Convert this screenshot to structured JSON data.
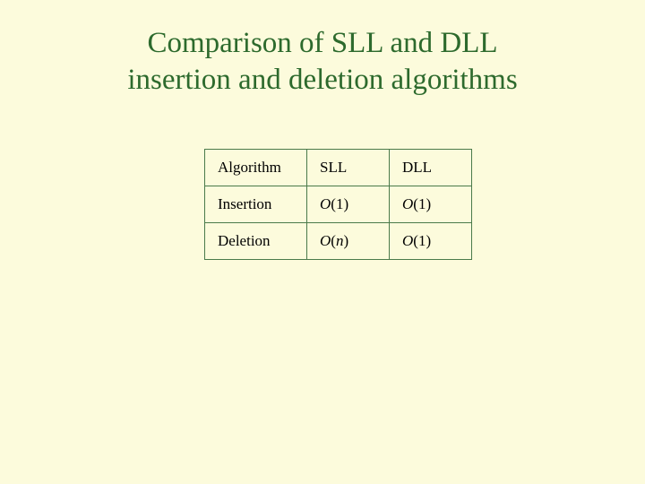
{
  "title_line1": "Comparison of SLL and DLL",
  "title_line2": "insertion and deletion algorithms",
  "chart_data": {
    "type": "table",
    "headers": [
      "Algorithm",
      "SLL",
      "DLL"
    ],
    "rows": [
      {
        "alg": "Insertion",
        "sll_o": "O",
        "sll_n": "(1)",
        "dll_o": "O",
        "dll_n": "(1)"
      },
      {
        "alg": "Deletion",
        "sll_o": "O",
        "sll_n_ital": "n",
        "sll_open": "(",
        "sll_close": ")",
        "dll_o": "O",
        "dll_n": "(1)"
      }
    ]
  }
}
